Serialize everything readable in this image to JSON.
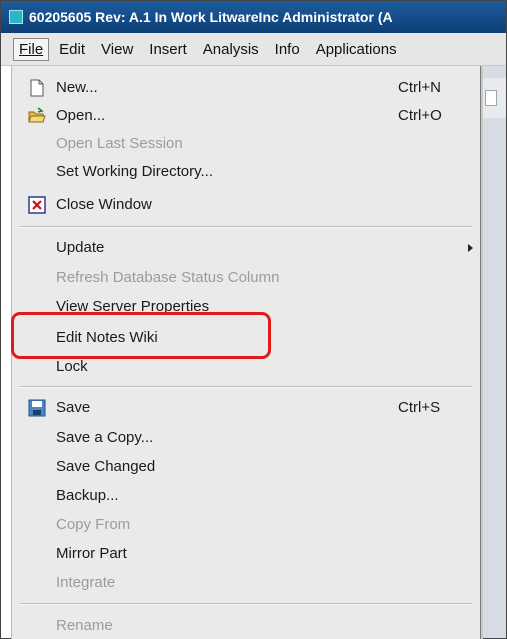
{
  "window": {
    "title": "60205605 Rev: A.1 In Work LitwareInc Administrator (A"
  },
  "menubar": {
    "items": [
      "File",
      "Edit",
      "View",
      "Insert",
      "Analysis",
      "Info",
      "Applications"
    ],
    "active": "File"
  },
  "file_menu": {
    "new": {
      "label": "New...",
      "shortcut": "Ctrl+N"
    },
    "open": {
      "label": "Open...",
      "shortcut": "Ctrl+O"
    },
    "open_last_session": {
      "label": "Open Last Session"
    },
    "set_working_directory": {
      "label": "Set Working Directory..."
    },
    "close_window": {
      "label": "Close Window"
    },
    "update": {
      "label": "Update"
    },
    "refresh_status": {
      "label": "Refresh Database Status Column"
    },
    "view_server_properties": {
      "label": "View Server Properties"
    },
    "edit_notes_wiki": {
      "label": "Edit Notes Wiki"
    },
    "lock": {
      "label": "Lock"
    },
    "save": {
      "label": "Save",
      "shortcut": "Ctrl+S"
    },
    "save_a_copy": {
      "label": "Save a Copy..."
    },
    "save_changed": {
      "label": "Save Changed"
    },
    "backup": {
      "label": "Backup..."
    },
    "copy_from": {
      "label": "Copy From"
    },
    "mirror_part": {
      "label": "Mirror Part"
    },
    "integrate": {
      "label": "Integrate"
    },
    "rename": {
      "label": "Rename"
    }
  },
  "colors": {
    "title_bar": "#0e3f76",
    "menu_background": "#eaeaea",
    "highlight_box": "#e01b1b"
  }
}
